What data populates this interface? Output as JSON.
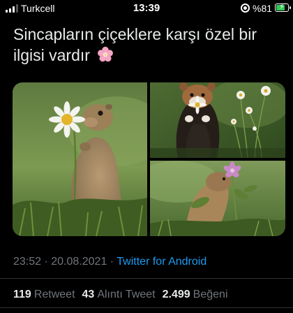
{
  "status_bar": {
    "carrier": "Turkcell",
    "time": "13:39",
    "battery": "%81",
    "battery_level": 0.81,
    "signal_bars": 3,
    "icons": [
      "signal-icon",
      "orientation-lock-icon",
      "battery-charging-icon"
    ]
  },
  "tweet": {
    "text": "Sincapların çiçeklere karşı özel bir ilgisi vardır",
    "emoji": "cherry-blossom-icon",
    "media_count": 3,
    "timestamp": "23:52 · 20.08.2021",
    "separator": " · ",
    "source": "Twitter for Android"
  },
  "stats": {
    "retweets": {
      "count": "119",
      "label": "Retweet"
    },
    "quotes": {
      "count": "43",
      "label": "Alıntı Tweet"
    },
    "likes": {
      "count": "2.499",
      "label": "Beğeni"
    }
  },
  "colors": {
    "background": "#000000",
    "text": "#e7e9ea",
    "muted": "#71767b",
    "link": "#1d9bf0",
    "battery": "#34c759"
  }
}
